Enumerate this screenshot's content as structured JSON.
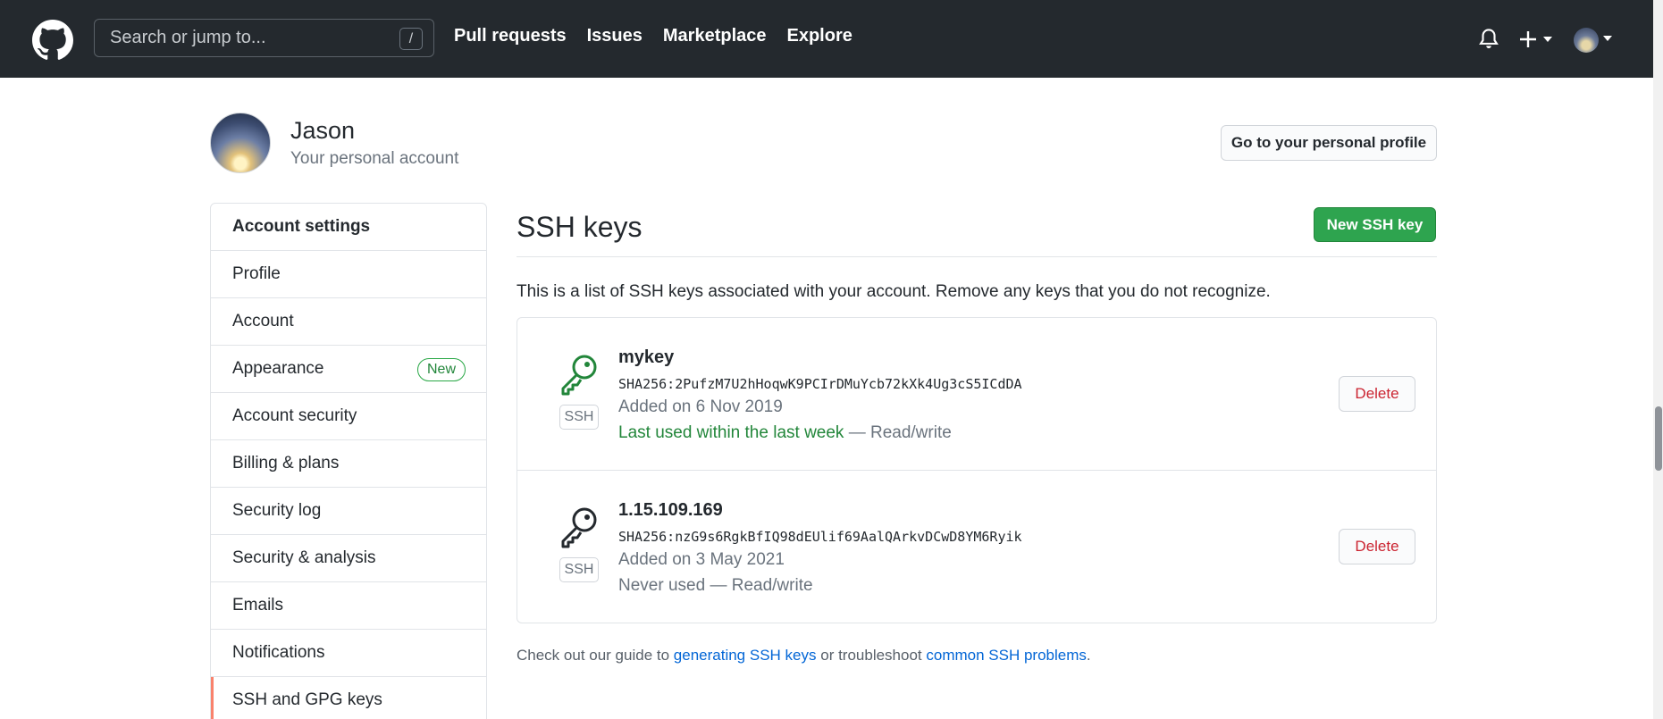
{
  "header": {
    "logo_icon": "github-mark-icon",
    "search_placeholder": "Search or jump to...",
    "search_shortcut": "/",
    "nav": [
      "Pull requests",
      "Issues",
      "Marketplace",
      "Explore"
    ],
    "icons": [
      "bell-icon",
      "plus-icon",
      "avatar"
    ]
  },
  "profile": {
    "name": "Jason",
    "subtitle": "Your personal account",
    "go_profile_label": "Go to your personal profile"
  },
  "sidebar": {
    "heading": "Account settings",
    "items": [
      {
        "label": "Profile"
      },
      {
        "label": "Account"
      },
      {
        "label": "Appearance",
        "badge": "New"
      },
      {
        "label": "Account security"
      },
      {
        "label": "Billing & plans"
      },
      {
        "label": "Security log"
      },
      {
        "label": "Security & analysis"
      },
      {
        "label": "Emails"
      },
      {
        "label": "Notifications"
      },
      {
        "label": "SSH and GPG keys",
        "selected": true
      }
    ]
  },
  "main": {
    "title": "SSH keys",
    "new_key_label": "New SSH key",
    "intro": "This is a list of SSH keys associated with your account. Remove any keys that you do not recognize.",
    "keys": [
      {
        "title": "mykey",
        "fingerprint": "SHA256:2PufzM7U2hHoqwK9PCIrDMuYcb72kXk4Ug3cS5ICdDA",
        "added": "Added on 6 Nov 2019",
        "usage": "Last used within the last week",
        "access": "— Read/write",
        "badge": "SSH",
        "delete_label": "Delete",
        "icon_color": "#22863a"
      },
      {
        "title": "1.15.109.169",
        "fingerprint": "SHA256:nzG9s6RgkBfIQ98dEUlif69AalQArkvDCwD8YM6Ryik",
        "added": "Added on 3 May 2021",
        "usage": "Never used",
        "access": "— Read/write",
        "badge": "SSH",
        "delete_label": "Delete",
        "icon_color": "#24292e"
      }
    ],
    "guide": {
      "prefix": "Check out our guide to",
      "link1": "generating SSH keys",
      "middle": "or troubleshoot",
      "link2": "common SSH problems",
      "suffix": "."
    }
  },
  "colors": {
    "header_bg": "#24292e",
    "primary_green": "#2ea44f",
    "danger": "#cb2431",
    "link": "#0366d6",
    "selected_accent": "#f9826c"
  }
}
